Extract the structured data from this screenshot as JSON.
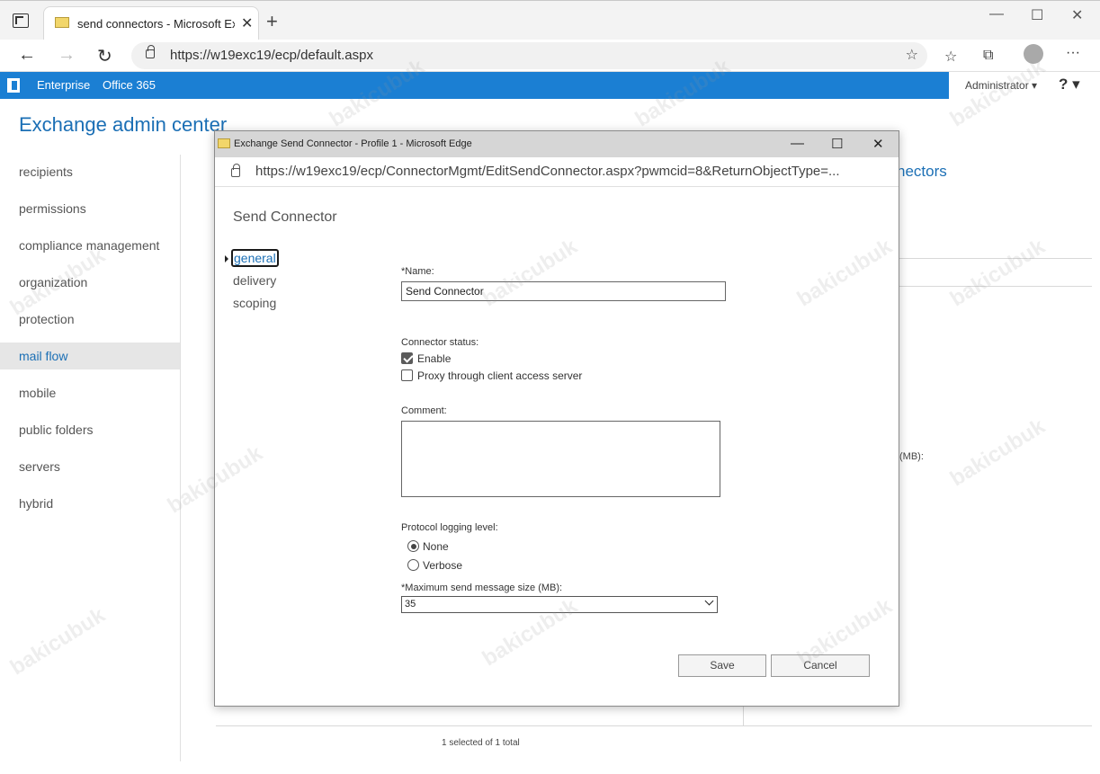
{
  "browser": {
    "tab_title": "send connectors - Microsoft Exchange",
    "tab_close": "✕",
    "new_tab": "+",
    "win_min": "—",
    "win_max": "☐",
    "win_close": "✕",
    "back": "←",
    "forward": "→",
    "refresh": "↻",
    "url": "https://w19exc19/ecp/default.aspx",
    "more": "···"
  },
  "exchange": {
    "nav_enterprise": "Enterprise",
    "nav_office365": "Office 365",
    "admin_label": "Administrator ▾",
    "help_label": "? ▾",
    "title": "Exchange admin center",
    "accent_color": "#1b7fd3"
  },
  "leftnav": {
    "items": [
      "recipients",
      "permissions",
      "compliance management",
      "organization",
      "protection",
      "mail flow",
      "mobile",
      "public folders",
      "servers",
      "hybrid"
    ],
    "active": "mail flow"
  },
  "background": {
    "connectors_link": "nectors",
    "mb_fragment": "(MB):",
    "status": "1 selected of 1 total"
  },
  "popup": {
    "window_title": "Exchange Send Connector - Profile 1 - Microsoft Edge",
    "ctrl_min": "—",
    "ctrl_max": "☐",
    "ctrl_close": "✕",
    "url": "https://w19exc19/ecp/ConnectorMgmt/EditSendConnector.aspx?pwmcid=8&ReturnObjectType=...",
    "heading": "Send Connector",
    "tabs": {
      "general": "general",
      "delivery": "delivery",
      "scoping": "scoping"
    },
    "form": {
      "name_label": "*Name:",
      "name_value": "Send Connector",
      "status_label": "Connector status:",
      "enable_label": "Enable",
      "proxy_label": "Proxy through client access server",
      "comment_label": "Comment:",
      "logging_label": "Protocol logging level:",
      "none_label": "None",
      "verbose_label": "Verbose",
      "max_size_label": "*Maximum send message size (MB):",
      "max_size_value": "35"
    },
    "buttons": {
      "save": "Save",
      "cancel": "Cancel"
    }
  },
  "watermark": "bakicubuk"
}
